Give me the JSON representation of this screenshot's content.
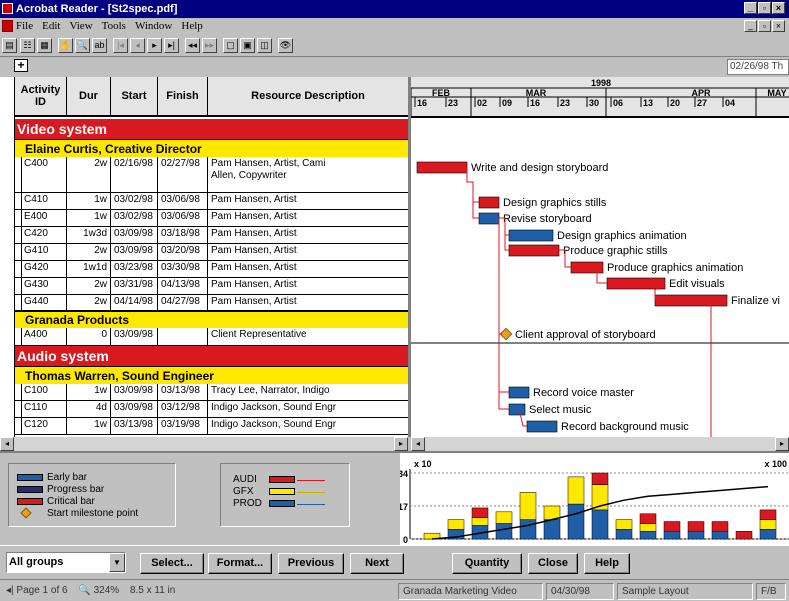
{
  "titlebar": {
    "title": "Acrobat Reader - [St2spec.pdf]",
    "min": "_",
    "close": "×"
  },
  "menubar": {
    "items": [
      "File",
      "Edit",
      "View",
      "Tools",
      "Window",
      "Help"
    ]
  },
  "header": {
    "plus": "+",
    "date": "02/26/98 Th"
  },
  "table": {
    "headers": {
      "id": "Activity ID",
      "dur": "Dur",
      "start": "Start",
      "finish": "Finish",
      "resource": "Resource Description"
    },
    "bands": [
      {
        "kind": "group",
        "label": "Video system"
      },
      {
        "kind": "sub",
        "label": "Elaine Curtis, Creative Director"
      },
      {
        "kind": "sub",
        "label": "Granada Products"
      },
      {
        "kind": "group",
        "label": "Audio system"
      },
      {
        "kind": "sub",
        "label": "Thomas Warren, Sound Engineer"
      }
    ],
    "rows": [
      {
        "id": "C400",
        "dur": "2w",
        "start": "02/16/98",
        "finish": "02/27/98",
        "resource": "Pam Hansen, Artist, Cami",
        "resource2": "Allen, Copywriter"
      },
      {
        "id": "C410",
        "dur": "1w",
        "start": "03/02/98",
        "finish": "03/06/98",
        "resource": "Pam Hansen, Artist"
      },
      {
        "id": "E400",
        "dur": "1w",
        "start": "03/02/98",
        "finish": "03/06/98",
        "resource": "Pam Hansen, Artist"
      },
      {
        "id": "C420",
        "dur": "1w3d",
        "start": "03/09/98",
        "finish": "03/18/98",
        "resource": "Pam Hansen, Artist"
      },
      {
        "id": "G410",
        "dur": "2w",
        "start": "03/09/98",
        "finish": "03/20/98",
        "resource": "Pam Hansen, Artist"
      },
      {
        "id": "G420",
        "dur": "1w1d",
        "start": "03/23/98",
        "finish": "03/30/98",
        "resource": "Pam Hansen, Artist"
      },
      {
        "id": "G430",
        "dur": "2w",
        "start": "03/31/98",
        "finish": "04/13/98",
        "resource": "Pam Hansen, Artist"
      },
      {
        "id": "G440",
        "dur": "2w",
        "start": "04/14/98",
        "finish": "04/27/98",
        "resource": "Pam Hansen, Artist"
      },
      {
        "id": "A400",
        "dur": "0",
        "start": "03/09/98",
        "finish": "",
        "resource": "Client Representative"
      },
      {
        "id": "C100",
        "dur": "1w",
        "start": "03/09/98",
        "finish": "03/13/98",
        "resource": "Tracy Lee, Narrator, Indigo"
      },
      {
        "id": "C110",
        "dur": "4d",
        "start": "03/09/98",
        "finish": "03/12/98",
        "resource": "Indigo Jackson, Sound Engr"
      },
      {
        "id": "C120",
        "dur": "1w",
        "start": "03/13/98",
        "finish": "03/19/98",
        "resource": "Indigo Jackson, Sound Engr"
      }
    ]
  },
  "timescale": {
    "year": "1998",
    "months": [
      "FEB",
      "MAR",
      "APR",
      "MAY"
    ],
    "days": [
      "16",
      "23",
      "02",
      "09",
      "16",
      "23",
      "30",
      "06",
      "13",
      "20",
      "27",
      "04"
    ]
  },
  "gantt_labels": [
    "Write and design storyboard",
    "Design graphics stills",
    "Revise storyboard",
    "Design graphics animation",
    "Produce graphic stills",
    "Produce graphics animation",
    "Edit visuals",
    "Finalize vi",
    "Client approval of storyboard",
    "Record voice master",
    "Select music",
    "Record background music"
  ],
  "legend": {
    "bars": [
      "Early bar",
      "Progress bar",
      "Critical bar",
      "Start milestone point"
    ],
    "resources": [
      "AUDI",
      "GFX",
      "PROD"
    ]
  },
  "colors": {
    "critical": "#d81920",
    "early": "#1f5fa8",
    "progress": "#2a2a6e",
    "gfx": "#ffe800",
    "group_band": "#d81920",
    "sub_band": "#ffe800"
  },
  "histogram": {
    "scale_left": "x 10",
    "scale_right": "x 100",
    "ticks": [
      "34",
      "17",
      "0"
    ]
  },
  "chart_data": {
    "type": "bar",
    "title": "",
    "xlabel": "",
    "ylabel": "",
    "ylim": [
      0,
      34
    ],
    "series": [
      {
        "name": "AUDI",
        "values": [
          0,
          0,
          5,
          0,
          0,
          0,
          0,
          6,
          0,
          5,
          5,
          5,
          5,
          4,
          5
        ]
      },
      {
        "name": "GFX",
        "values": [
          3,
          5,
          4,
          6,
          14,
          7,
          14,
          13,
          5,
          4,
          0,
          0,
          0,
          0,
          5
        ]
      },
      {
        "name": "PROD",
        "values": [
          0,
          5,
          7,
          8,
          10,
          10,
          18,
          15,
          5,
          4,
          4,
          4,
          4,
          0,
          5
        ]
      }
    ],
    "cumulative_line": [
      0,
      1,
      3,
      5,
      7,
      10,
      13,
      17,
      20,
      22,
      23,
      24,
      25,
      26,
      27
    ]
  },
  "buttons": {
    "select": "Select...",
    "format": "Format...",
    "previous": "Previous",
    "next": "Next",
    "quantity": "Quantity",
    "close": "Close",
    "help": "Help"
  },
  "filter": {
    "value": "All groups"
  },
  "status": {
    "page": "Page 1 of 6",
    "zoom": "324%",
    "size": "8.5 x 11 in",
    "project": "Granada Marketing Video",
    "date": "04/30/98",
    "layout": "Sample Layout",
    "code": "F/B"
  }
}
